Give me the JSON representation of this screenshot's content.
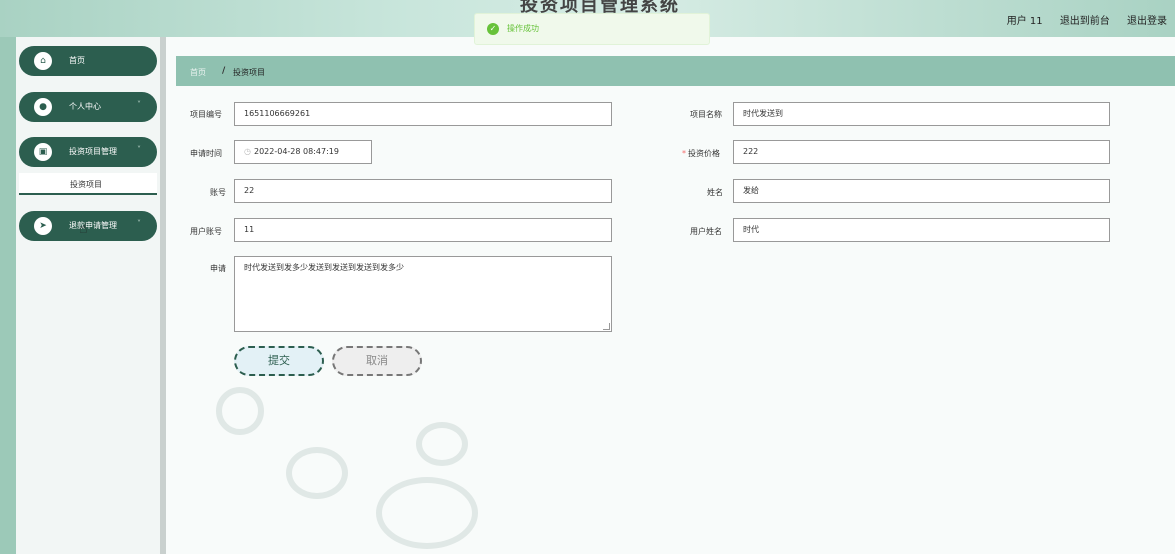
{
  "header": {
    "title": "投资项目管理系统",
    "user": "用户 11",
    "back_to_front": "退出到前台",
    "logout": "退出登录"
  },
  "toast": {
    "message": "操作成功",
    "icon": "success-check-icon"
  },
  "sidebar": {
    "items": [
      {
        "label": "首页",
        "icon": "home-icon"
      },
      {
        "label": "个人中心",
        "icon": "user-icon"
      },
      {
        "label": "投资项目管理",
        "icon": "briefcase-icon"
      },
      {
        "label": "退款申请管理",
        "icon": "send-icon"
      }
    ],
    "subitem": "投资项目",
    "chevron": "˅"
  },
  "breadcrumb": {
    "home": "首页",
    "separator": "/",
    "current": "投资项目"
  },
  "form": {
    "project_no": {
      "label": "项目编号",
      "value": "1651106669261"
    },
    "project_name": {
      "label": "项目名称",
      "value": "时代发送到"
    },
    "apply_time": {
      "label": "申请时间",
      "value": "2022-04-28 08:47:19"
    },
    "price": {
      "label": "投资价格",
      "value": "222",
      "required_mark": "*"
    },
    "account": {
      "label": "账号",
      "value": "22"
    },
    "name": {
      "label": "姓名",
      "value": "发给"
    },
    "user_account": {
      "label": "用户账号",
      "value": "11"
    },
    "user_name": {
      "label": "用户姓名",
      "value": "时代"
    },
    "application": {
      "label": "申请",
      "value": "时代发送到发多少发送到发送到发送到发多少"
    }
  },
  "buttons": {
    "submit": "提交",
    "cancel": "取消"
  }
}
